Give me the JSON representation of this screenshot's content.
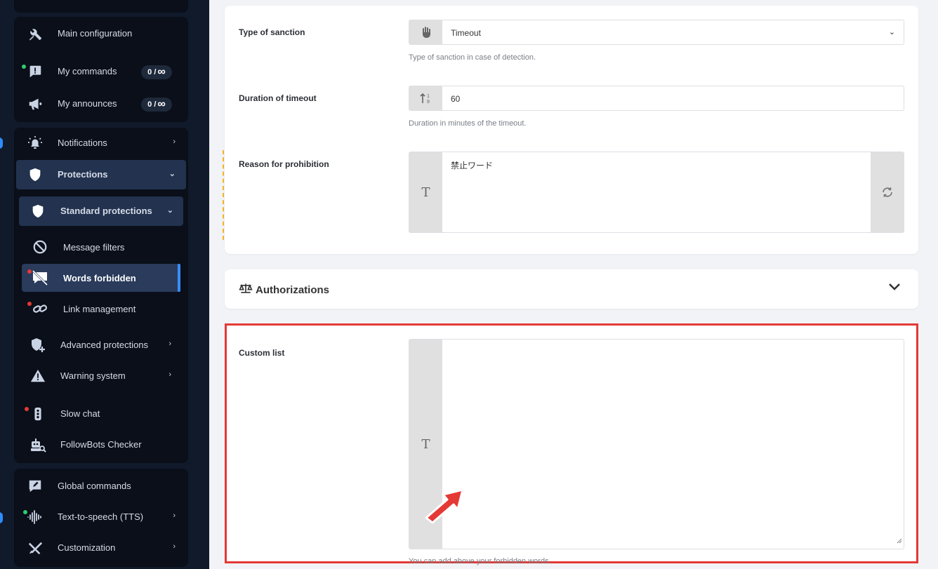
{
  "sidebar": {
    "items": [
      {
        "label": "Main configuration",
        "icon": "tools-icon"
      },
      {
        "label": "My commands",
        "icon": "command-icon",
        "badge_count": "0 /",
        "badge_limit": "∞"
      },
      {
        "label": "My announces",
        "icon": "megaphone-icon",
        "badge_count": "0 /",
        "badge_limit": "∞"
      },
      {
        "label": "Notifications",
        "icon": "bell-icon"
      },
      {
        "label": "Protections",
        "icon": "shield-icon"
      },
      {
        "label": "Global commands",
        "icon": "chat-edit-icon"
      },
      {
        "label": "Text-to-speech (TTS)",
        "icon": "audio-wave-icon"
      },
      {
        "label": "Customization",
        "icon": "brush-icon"
      }
    ],
    "sub": [
      {
        "label": "Standard protections",
        "icon": "shield-icon"
      },
      {
        "label": "Advanced protections",
        "icon": "shield-plus-icon"
      },
      {
        "label": "Warning system",
        "icon": "warning-icon"
      },
      {
        "label": "Slow chat",
        "icon": "traffic-light-icon"
      },
      {
        "label": "FollowBots Checker",
        "icon": "robot-search-icon"
      }
    ],
    "leaves": [
      {
        "label": "Message filters",
        "icon": "ban-icon"
      },
      {
        "label": "Words forbidden",
        "icon": "no-message-icon"
      },
      {
        "label": "Link management",
        "icon": "link-icon"
      }
    ]
  },
  "form": {
    "sanction": {
      "label": "Type of sanction",
      "value": "Timeout",
      "help": "Type of sanction in case of detection."
    },
    "duration": {
      "label": "Duration of timeout",
      "value": "60",
      "help": "Duration in minutes of the timeout."
    },
    "reason": {
      "label": "Reason for prohibition",
      "value": "禁止ワード"
    },
    "authorizations": {
      "title": "Authorizations"
    },
    "custom_list": {
      "label": "Custom list",
      "value": "",
      "help": "You can add above your forbidden words."
    }
  },
  "colors": {
    "accent": "#3a8dff",
    "highlight": "#e53935",
    "sidebar": "#111a2b"
  }
}
